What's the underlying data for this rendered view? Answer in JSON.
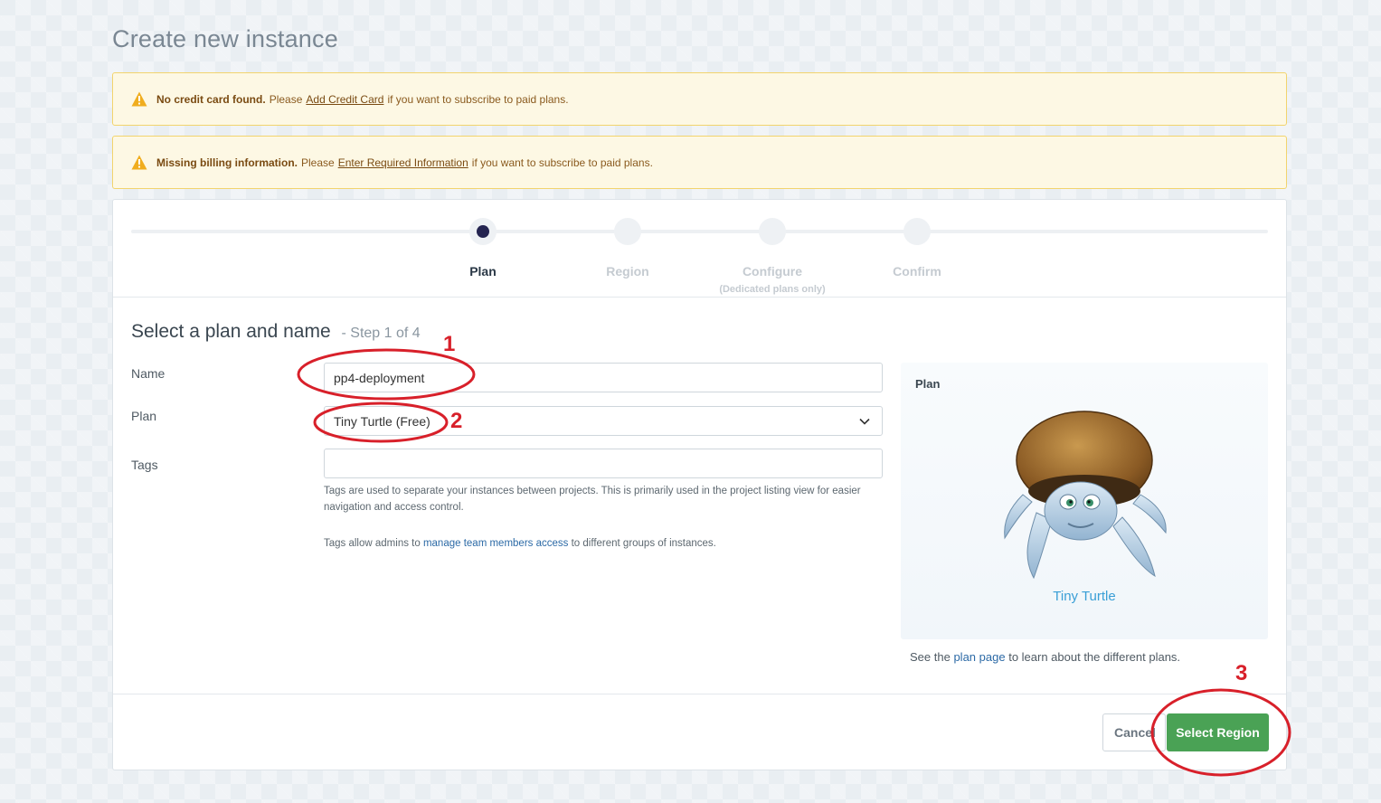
{
  "page": {
    "title": "Create new instance"
  },
  "alerts": [
    {
      "strong": "No credit card found.",
      "pre": "Please",
      "link": "Add Credit Card",
      "post": "if you want to subscribe to paid plans."
    },
    {
      "strong": "Missing billing information.",
      "pre": "Please",
      "link": "Enter Required Information",
      "post": "if you want to subscribe to paid plans."
    }
  ],
  "stepper": {
    "steps": [
      {
        "label": "Plan",
        "active": true
      },
      {
        "label": "Region",
        "active": false
      },
      {
        "label": "Configure",
        "sub": "(Dedicated plans only)",
        "active": false
      },
      {
        "label": "Confirm",
        "active": false
      }
    ]
  },
  "form": {
    "title": "Select a plan and name",
    "step_of": "- Step 1 of 4",
    "name_label": "Name",
    "name_value": "pp4-deployment",
    "plan_label": "Plan",
    "plan_value": "Tiny Turtle (Free)",
    "tags_label": "Tags",
    "tags_value": "",
    "tags_help_1": "Tags are used to separate your instances between projects. This is primarily used in the project listing view for easier navigation and access control.",
    "tags_help_2_pre": "Tags allow admins to",
    "tags_help_2_link": "manage team members access",
    "tags_help_2_post": "to different groups of instances."
  },
  "plan_panel": {
    "heading": "Plan",
    "plan_name": "Tiny Turtle",
    "note_pre": "See the",
    "note_link": "plan page",
    "note_post": "to learn about the different plans."
  },
  "actions": {
    "cancel": "Cancel",
    "primary": "Select Region"
  },
  "annotations": {
    "one": "1",
    "two": "2",
    "three": "3",
    "color": "#d8202a"
  },
  "colors": {
    "accent": "#4aa255",
    "warning_bg": "#fdf8e4",
    "active_step": "#242450",
    "link": "#2c6aa6"
  }
}
